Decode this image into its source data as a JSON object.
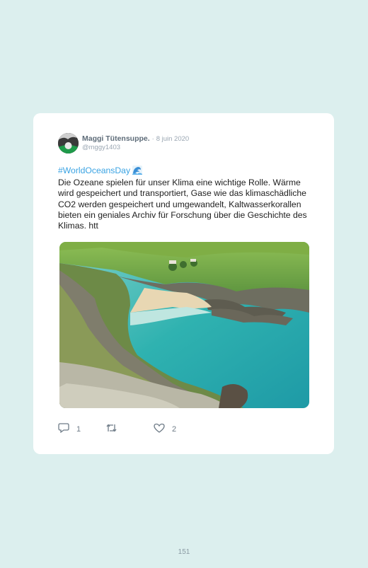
{
  "tweet": {
    "author_name": "Maggi Tütensuppe.",
    "separator": "·",
    "date": "8 juin 2020",
    "handle": "@mggy1403",
    "hashtag": "#WorldOceansDay",
    "hashtag_icon": "wave-emoji",
    "body": "Die Ozeane spielen für unser Klima eine wichtige Rolle. Wärme wird gespeichert und transportiert, Gase wie das klimaschädliche CO2 werden gespeichert und umgewandelt, Kaltwasserkorallen bieten ein geniales Archiv für Forschung über die Geschichte des Klimas. htt",
    "image": "coastal-cove-photo",
    "actions": {
      "reply_icon": "comment-icon",
      "reply_count": "1",
      "retweet_icon": "retweet-icon",
      "like_icon": "heart-icon",
      "like_count": "2"
    }
  },
  "page_number": "151",
  "colors": {
    "background": "#dcefee",
    "card": "#ffffff",
    "hashtag": "#3aa3e3",
    "meta_text": "#9aa6b2"
  }
}
